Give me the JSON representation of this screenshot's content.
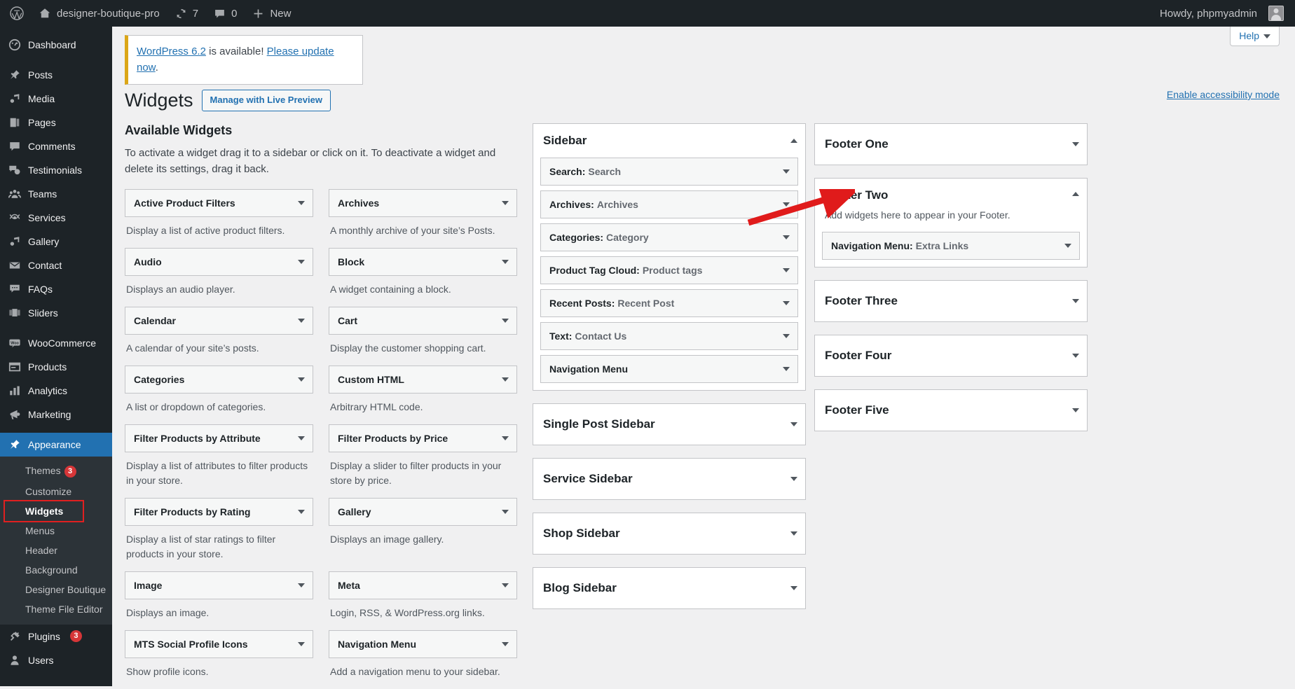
{
  "adminbar": {
    "site_title": "designer-boutique-pro",
    "updates_count": "7",
    "comments_count": "0",
    "new_label": "New",
    "howdy": "Howdy, phpmyadmin"
  },
  "sidebar": {
    "items": [
      {
        "label": "Dashboard",
        "icon": "dashboard-icon"
      },
      {
        "label": "Posts",
        "icon": "pin-icon"
      },
      {
        "label": "Media",
        "icon": "media-icon"
      },
      {
        "label": "Pages",
        "icon": "pages-icon"
      },
      {
        "label": "Comments",
        "icon": "comment-icon"
      },
      {
        "label": "Testimonials",
        "icon": "testimonials-icon"
      },
      {
        "label": "Teams",
        "icon": "teams-icon"
      },
      {
        "label": "Services",
        "icon": "services-icon"
      },
      {
        "label": "Gallery",
        "icon": "gallery-icon"
      },
      {
        "label": "Contact",
        "icon": "mail-icon"
      },
      {
        "label": "FAQs",
        "icon": "faq-icon"
      },
      {
        "label": "Sliders",
        "icon": "sliders-icon"
      },
      {
        "label": "WooCommerce",
        "icon": "woocommerce-icon"
      },
      {
        "label": "Products",
        "icon": "products-icon"
      },
      {
        "label": "Analytics",
        "icon": "analytics-icon"
      },
      {
        "label": "Marketing",
        "icon": "marketing-icon"
      },
      {
        "label": "Appearance",
        "icon": "appearance-icon",
        "current": true
      },
      {
        "label": "Plugins",
        "icon": "plugins-icon",
        "badge": "3"
      },
      {
        "label": "Users",
        "icon": "users-icon"
      }
    ],
    "appearance_submenu": [
      {
        "label": "Themes",
        "badge": "3"
      },
      {
        "label": "Customize"
      },
      {
        "label": "Widgets",
        "current": true,
        "highlighted": true
      },
      {
        "label": "Menus"
      },
      {
        "label": "Header"
      },
      {
        "label": "Background"
      },
      {
        "label": "Designer Boutique"
      },
      {
        "label": "Theme File Editor"
      }
    ]
  },
  "header": {
    "help_label": "Help",
    "notice_link": "WordPress 6.2",
    "notice_mid": " is available! ",
    "notice_link2": "Please update now",
    "notice_end": ".",
    "page_title": "Widgets",
    "live_preview_button": "Manage with Live Preview",
    "accessibility_link": "Enable accessibility mode"
  },
  "available": {
    "heading": "Available Widgets",
    "description": "To activate a widget drag it to a sidebar or click on it. To deactivate a widget and delete its settings, drag it back.",
    "widgets": [
      {
        "title": "Active Product Filters",
        "desc": "Display a list of active product filters."
      },
      {
        "title": "Archives",
        "desc": "A monthly archive of your site’s Posts."
      },
      {
        "title": "Audio",
        "desc": "Displays an audio player."
      },
      {
        "title": "Block",
        "desc": "A widget containing a block."
      },
      {
        "title": "Calendar",
        "desc": "A calendar of your site’s posts."
      },
      {
        "title": "Cart",
        "desc": "Display the customer shopping cart."
      },
      {
        "title": "Categories",
        "desc": "A list or dropdown of categories."
      },
      {
        "title": "Custom HTML",
        "desc": "Arbitrary HTML code."
      },
      {
        "title": "Filter Products by Attribute",
        "desc": "Display a list of attributes to filter products in your store."
      },
      {
        "title": "Filter Products by Price",
        "desc": "Display a slider to filter products in your store by price."
      },
      {
        "title": "Filter Products by Rating",
        "desc": "Display a list of star ratings to filter products in your store."
      },
      {
        "title": "Gallery",
        "desc": "Displays an image gallery."
      },
      {
        "title": "Image",
        "desc": "Displays an image."
      },
      {
        "title": "Meta",
        "desc": "Login, RSS, & WordPress.org links."
      },
      {
        "title": "MTS Social Profile Icons",
        "desc": "Show profile icons."
      },
      {
        "title": "Navigation Menu",
        "desc": "Add a navigation menu to your sidebar."
      }
    ]
  },
  "middle_column": {
    "panels": [
      {
        "name": "Sidebar",
        "expanded": true,
        "widgets": [
          {
            "type": "Search:",
            "instance": "Search"
          },
          {
            "type": "Archives:",
            "instance": "Archives"
          },
          {
            "type": "Categories:",
            "instance": "Category"
          },
          {
            "type": "Product Tag Cloud:",
            "instance": "Product tags"
          },
          {
            "type": "Recent Posts:",
            "instance": "Recent Post"
          },
          {
            "type": "Text:",
            "instance": "Contact Us"
          },
          {
            "type": "Navigation Menu",
            "instance": ""
          }
        ]
      },
      {
        "name": "Single Post Sidebar",
        "expanded": false,
        "widgets": []
      },
      {
        "name": "Service Sidebar",
        "expanded": false,
        "widgets": []
      },
      {
        "name": "Shop Sidebar",
        "expanded": false,
        "widgets": []
      },
      {
        "name": "Blog Sidebar",
        "expanded": false,
        "widgets": []
      }
    ]
  },
  "right_column": {
    "panels": [
      {
        "name": "Footer One",
        "expanded": false,
        "desc": "",
        "widgets": []
      },
      {
        "name": "Footer Two",
        "expanded": true,
        "desc": "Add widgets here to appear in your Footer.",
        "widgets": [
          {
            "type": "Navigation Menu:",
            "instance": "Extra Links",
            "highlighted": true
          }
        ]
      },
      {
        "name": "Footer Three",
        "expanded": false,
        "desc": "",
        "widgets": []
      },
      {
        "name": "Footer Four",
        "expanded": false,
        "desc": "",
        "widgets": []
      },
      {
        "name": "Footer Five",
        "expanded": false,
        "desc": "",
        "widgets": []
      }
    ]
  },
  "annotation": {
    "arrow_color": "#e01b1b",
    "highlight_color": "#e02020"
  }
}
